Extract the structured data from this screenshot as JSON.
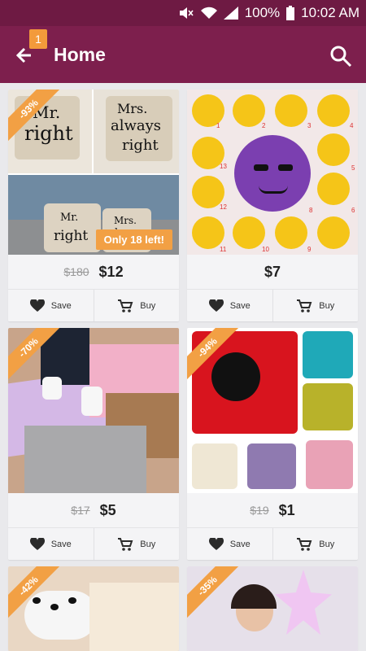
{
  "status": {
    "time": "10:02 AM",
    "battery": "100%"
  },
  "header": {
    "title": "Home",
    "notification_count": "1"
  },
  "products": [
    {
      "discount": "-93%",
      "old_price": "$180",
      "price": "$12",
      "stock_tag": "Only 18 left!",
      "save": "Save",
      "buy": "Buy",
      "image_text": {
        "mr": "Mr.",
        "right": "right",
        "mrs": "Mrs.",
        "always": "always",
        "right2": "right",
        "mr2": "Mr.",
        "right3": "right",
        "mrs2": "Mrs.",
        "always2": "alwaus"
      }
    },
    {
      "discount": "",
      "old_price": "",
      "price": "$7",
      "save": "Save",
      "buy": "Buy",
      "image_text": {
        "n1": "1",
        "n2": "2",
        "n3": "3",
        "n4": "4",
        "n13": "13",
        "n5": "5",
        "n12": "12",
        "n6": "6",
        "n8": "8",
        "n11": "11",
        "n10": "10",
        "n9": "9"
      }
    },
    {
      "discount": "-70%",
      "old_price": "$17",
      "price": "$5",
      "save": "Save",
      "buy": "Buy"
    },
    {
      "discount": "-94%",
      "old_price": "$19",
      "price": "$1",
      "save": "Save",
      "buy": "Buy"
    },
    {
      "discount": "-42%"
    },
    {
      "discount": "-35%"
    }
  ]
}
